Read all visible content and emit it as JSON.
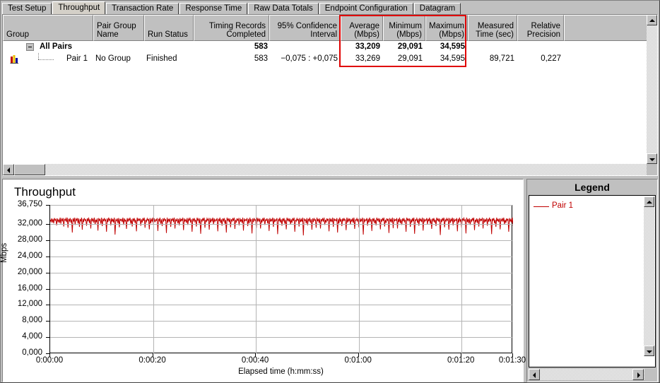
{
  "tabs": [
    {
      "label": "Test Setup",
      "active": false
    },
    {
      "label": "Throughput",
      "active": true
    },
    {
      "label": "Transaction Rate",
      "active": false
    },
    {
      "label": "Response Time",
      "active": false
    },
    {
      "label": "Raw Data Totals",
      "active": false
    },
    {
      "label": "Endpoint Configuration",
      "active": false
    },
    {
      "label": "Datagram",
      "active": false
    }
  ],
  "table": {
    "columns": [
      {
        "header_line1": "Group",
        "header_line2": "",
        "align": "l"
      },
      {
        "header_line1": "Pair Group",
        "header_line2": "Name",
        "align": "l"
      },
      {
        "header_line1": "Run Status",
        "header_line2": "",
        "align": "l"
      },
      {
        "header_line1": "Timing Records",
        "header_line2": "Completed",
        "align": "r"
      },
      {
        "header_line1": "95% Confidence",
        "header_line2": "Interval",
        "align": "r"
      },
      {
        "header_line1": "Average",
        "header_line2": "(Mbps)",
        "align": "r"
      },
      {
        "header_line1": "Minimum",
        "header_line2": "(Mbps)",
        "align": "r"
      },
      {
        "header_line1": "Maximum",
        "header_line2": "(Mbps)",
        "align": "r"
      },
      {
        "header_line1": "Measured",
        "header_line2": "Time (sec)",
        "align": "r"
      },
      {
        "header_line1": "Relative",
        "header_line2": "Precision",
        "align": "r"
      },
      {
        "header_line1": "",
        "header_line2": "",
        "align": "l"
      }
    ],
    "rows": [
      {
        "group": "All Pairs",
        "pair_group_name": "",
        "run_status": "",
        "timing_records_completed": "583",
        "confidence_interval": "",
        "average_mbps": "33,209",
        "minimum_mbps": "29,091",
        "maximum_mbps": "34,595",
        "measured_time_sec": "",
        "relative_precision": ""
      },
      {
        "group": "Pair 1",
        "pair_group_name": "No Group",
        "run_status": "Finished",
        "timing_records_completed": "583",
        "confidence_interval": "−0,075 : +0,075",
        "average_mbps": "33,269",
        "minimum_mbps": "29,091",
        "maximum_mbps": "34,595",
        "measured_time_sec": "89,721",
        "relative_precision": "0,227"
      }
    ],
    "highlight_color": "#e00000"
  },
  "legend": {
    "title": "Legend",
    "items": [
      {
        "label": "Pair 1",
        "color": "#c00000"
      }
    ]
  },
  "chart_data": {
    "type": "line",
    "title": "Throughput",
    "xlabel": "Elapsed time (h:mm:ss)",
    "ylabel": "Mbps",
    "ylim": [
      0,
      36.75
    ],
    "ytick_labels": [
      "0,000",
      "4,000",
      "8,000",
      "12,000",
      "16,000",
      "20,000",
      "24,000",
      "28,000",
      "32,000",
      "36,750"
    ],
    "ytick_values": [
      0,
      4,
      8,
      12,
      16,
      20,
      24,
      28,
      32,
      36.75
    ],
    "xtick_labels": [
      "0:00:00",
      "0:00:20",
      "0:00:40",
      "0:01:00",
      "0:01:20",
      "0:01:30"
    ],
    "xtick_values": [
      0,
      20,
      40,
      60,
      80,
      90
    ],
    "xlim": [
      0,
      90
    ],
    "grid": true,
    "legend_position": "right",
    "series": [
      {
        "name": "Pair 1",
        "color": "#c00000",
        "mean": 32.9,
        "min": 29.091,
        "max": 34.595,
        "values": [
          33.1,
          32.6,
          33.4,
          32.4,
          33.3,
          32.2,
          33.5,
          32.9,
          33.2,
          31.7,
          33.4,
          32.6,
          33.1,
          32.3,
          33.6,
          32.1,
          33.3,
          32.8,
          33.5,
          31.4,
          33.2,
          32.9,
          33.4,
          32.5,
          33.6,
          31.1,
          33.3,
          32.7,
          33.5,
          32.4,
          33.2,
          29.9,
          33.4,
          32.6,
          33.6,
          31.8,
          33.3,
          32.9,
          33.5,
          32.2,
          33.4,
          31.3,
          33.2,
          32.8,
          33.6,
          30.6,
          33.3,
          32.5,
          33.5,
          32.9,
          33.1,
          31.6,
          33.4,
          32.7,
          33.6,
          32.3,
          33.2,
          30.9,
          33.5,
          32.8,
          33.3,
          32.4,
          33.6,
          31.9,
          33.1,
          32.6,
          33.4,
          30.4,
          33.5,
          32.9,
          33.2,
          32.1,
          33.6,
          31.5,
          33.3,
          32.7,
          33.5,
          32.8,
          33.1,
          30.1,
          33.4,
          32.5,
          33.6,
          32.9,
          33.2,
          31.7,
          33.5,
          32.6,
          33.3,
          32.4,
          33.6,
          29.4,
          33.1,
          32.8,
          33.4,
          32.2,
          33.5,
          31.2,
          33.3,
          32.9,
          33.2,
          32.5,
          33.6,
          31.8,
          33.4,
          32.7,
          33.1,
          30.8,
          33.5,
          32.6,
          33.3,
          32.9,
          33.6,
          32.1,
          33.2,
          31.4,
          33.4,
          32.8,
          33.5,
          32.3,
          33.1,
          30.2,
          33.6,
          32.7,
          33.3,
          32.9,
          33.4,
          31.6,
          33.2,
          32.4,
          33.5,
          32.8,
          33.6,
          31.1,
          33.1,
          32.6,
          33.4,
          32.9,
          33.3,
          30.7,
          33.5,
          32.2,
          33.2,
          32.7,
          33.6,
          31.9,
          33.4,
          32.5,
          33.1,
          32.9,
          33.5,
          30.3,
          33.3,
          32.8,
          33.6,
          32.1,
          33.2,
          31.5,
          33.4,
          32.6,
          33.5,
          32.9,
          33.1,
          29.8,
          33.6,
          32.4,
          33.3,
          32.7,
          33.4,
          31.3,
          33.2,
          32.9,
          33.5,
          32.5,
          33.6,
          30.9,
          33.1,
          32.8,
          33.4,
          32.2,
          33.3,
          31.7,
          33.5,
          32.6,
          33.2,
          32.9,
          33.6,
          30.5,
          33.4,
          32.7,
          33.1,
          32.3,
          33.5,
          31.8,
          33.3,
          32.9,
          33.6,
          32.4,
          33.2,
          30.1,
          33.4,
          32.8,
          33.5,
          32.6,
          33.1,
          31.4,
          33.6,
          32.9,
          33.3,
          32.2,
          33.4,
          29.6,
          33.2,
          32.7,
          33.5,
          32.8,
          33.6,
          31.1,
          33.1,
          32.5,
          33.4,
          32.9,
          33.3,
          30.6,
          33.5,
          32.4,
          33.2,
          32.8,
          33.6,
          31.9,
          33.4,
          32.6,
          33.1,
          32.9,
          33.5,
          30.2,
          33.3,
          32.7,
          33.6,
          32.3,
          33.2,
          31.6,
          33.4,
          32.8,
          33.5,
          32.1,
          33.1,
          29.9,
          33.6,
          32.9,
          33.3,
          32.5,
          33.4,
          31.2,
          33.2,
          32.7,
          33.5,
          32.8,
          33.6,
          30.8,
          33.1,
          32.4,
          33.4,
          32.9,
          33.3,
          31.7,
          33.5,
          32.6,
          33.2,
          32.3,
          33.6,
          30.4,
          33.4,
          32.8,
          33.1,
          32.9,
          33.5,
          31.5,
          33.3,
          32.2,
          33.6,
          32.7,
          33.2,
          29.7,
          33.4,
          32.5,
          33.5,
          32.9,
          33.1,
          31.0,
          33.6,
          32.8,
          33.3,
          32.6,
          33.4,
          30.9,
          33.2,
          32.4,
          33.5,
          32.7,
          33.6,
          31.8,
          33.1,
          32.9,
          33.4,
          32.2,
          33.3,
          30.3,
          33.5,
          32.6,
          33.2,
          32.8,
          33.6,
          31.3,
          33.4,
          32.5,
          33.1,
          32.9,
          33.5,
          29.5,
          33.3,
          32.7,
          33.6,
          32.4,
          33.2,
          31.6,
          33.4,
          32.8,
          33.5,
          32.1,
          33.1,
          30.7,
          33.6,
          32.9,
          33.3,
          32.6,
          33.4,
          31.9,
          33.2,
          32.3,
          33.5,
          32.8,
          33.6,
          30.1,
          33.1,
          32.7,
          33.4,
          32.9,
          33.3,
          31.4,
          33.5,
          32.5,
          33.2,
          32.6,
          33.6,
          29.2,
          33.4,
          32.9,
          33.1,
          32.2,
          33.5,
          31.7,
          33.3,
          32.8,
          33.6,
          32.4,
          33.2,
          30.6,
          33.4,
          32.5,
          33.5,
          32.9,
          33.1,
          31.1,
          33.6,
          32.7,
          33.3,
          32.3,
          33.4,
          30.9,
          33.2,
          32.8,
          33.5,
          32.6,
          33.6,
          31.8,
          33.1,
          32.4,
          33.4,
          32.9,
          33.3,
          30.2,
          33.5,
          32.7,
          33.2,
          32.5,
          33.6,
          31.3,
          33.4,
          32.9,
          33.1,
          32.8,
          33.5,
          29.9,
          33.3,
          32.2,
          33.6,
          32.6,
          33.2,
          31.5,
          33.4,
          32.7,
          33.5,
          32.9,
          33.1,
          30.5,
          33.6,
          32.4,
          33.3,
          32.8,
          33.4,
          31.9,
          33.2,
          32.6,
          33.5,
          32.3,
          33.6,
          30.8,
          33.1,
          32.9,
          33.4,
          32.7,
          33.3,
          31.2,
          33.5,
          32.5,
          33.2,
          32.8,
          33.6,
          29.4,
          33.4,
          32.6,
          33.1,
          32.9,
          33.5,
          31.6,
          33.3,
          32.4,
          33.6,
          32.7,
          33.2,
          30.3,
          33.4,
          32.8,
          33.5,
          32.2,
          33.1,
          31.7,
          33.6,
          32.9,
          33.3,
          32.5,
          33.4,
          30.7,
          33.2,
          32.6,
          33.5,
          32.8,
          33.6,
          31.4,
          33.1,
          32.3,
          33.4,
          32.9,
          33.3,
          29.8,
          33.5,
          32.7,
          33.2,
          32.4,
          33.6,
          31.0,
          33.4,
          32.8,
          33.1,
          32.9,
          33.5,
          30.9,
          33.3,
          32.5,
          33.6,
          32.2,
          33.2,
          31.8,
          33.4,
          32.7,
          33.5,
          32.6,
          33.1,
          30.1,
          33.6,
          32.9,
          33.3,
          32.8,
          33.4,
          31.3,
          33.2,
          32.4,
          33.5,
          32.7,
          33.6,
          29.6,
          33.1,
          32.9,
          33.4,
          32.3,
          33.3,
          31.6,
          33.5,
          32.8,
          33.2,
          32.5,
          33.6,
          30.4,
          33.4,
          32.6,
          33.1,
          32.9,
          33.5,
          31.9,
          33.3,
          32.7,
          33.6,
          32.1,
          33.2,
          30.8,
          33.4,
          32.8,
          33.5,
          32.4,
          33.1,
          31.5,
          33.6,
          32.9,
          33.3,
          32.6,
          33.4,
          29.3,
          33.2,
          32.5,
          33.5,
          32.8,
          33.6,
          31.2,
          33.1,
          32.7,
          33.4,
          32.9,
          33.3,
          30.6,
          33.5,
          32.3,
          33.2,
          32.8,
          33.6,
          31.7,
          33.4,
          32.6,
          33.1,
          32.9,
          33.5,
          30.2,
          33.3,
          32.4,
          33.6,
          32.7,
          33.2,
          31.1,
          33.4,
          32.9,
          33.5,
          32.8,
          33.1,
          29.7,
          33.6,
          32.5,
          33.3,
          32.2,
          33.4,
          31.8,
          33.2,
          32.7,
          33.5,
          32.9,
          33.6,
          30.5,
          33.1,
          32.6,
          33.4,
          32.3,
          33.3,
          31.4,
          33.5,
          32.8,
          33.2,
          32.9,
          33.6,
          30.9,
          33.4,
          32.4,
          33.1,
          32.7,
          33.5,
          31.6,
          33.3,
          32.6,
          33.6,
          32.8,
          33.2,
          29.5,
          33.4,
          32.9,
          33.5,
          32.2,
          33.1,
          31.3,
          33.6,
          32.7,
          33.3,
          32.5,
          33.4,
          30.7,
          33.2,
          32.8,
          33.5,
          32.6,
          33.6,
          31.9,
          33.1,
          32.3,
          33.4,
          32.9,
          33.3,
          30.1,
          33.5,
          32.7,
          33.2,
          32.4,
          33.6,
          31.7
        ]
      }
    ]
  }
}
